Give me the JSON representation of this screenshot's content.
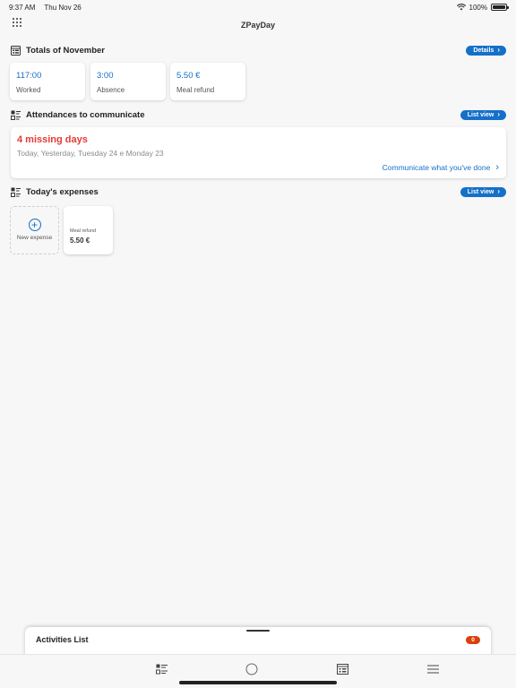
{
  "status": {
    "time": "9:37 AM",
    "date": "Thu Nov 26",
    "battery": "100%"
  },
  "app": {
    "title": "ZPayDay"
  },
  "totals": {
    "title": "Totals of November",
    "details_label": "Details",
    "cards": [
      {
        "value": "117:00",
        "label": "Worked"
      },
      {
        "value": "3:00",
        "label": "Absence"
      },
      {
        "value": "5.50 €",
        "label": "Meal refund"
      }
    ]
  },
  "attendances": {
    "title": "Attendances to communicate",
    "list_view_label": "List view",
    "missing": "4 missing days",
    "days": "Today, Yesterday, Tuesday 24 e Monday 23",
    "communicate_label": "Communicate what you've done"
  },
  "expenses": {
    "title": "Today's expenses",
    "list_view_label": "List view",
    "new_label": "New expense",
    "items": [
      {
        "type": "Meal refund",
        "amount": "5.50 €"
      }
    ]
  },
  "activities": {
    "title": "Activities List",
    "count": "0"
  },
  "colors": {
    "accent": "#1570c9",
    "alert": "#e53935",
    "badge": "#d9400c"
  },
  "tabs": [
    "list-icon",
    "circle-icon",
    "calendar-icon",
    "menu-icon"
  ]
}
